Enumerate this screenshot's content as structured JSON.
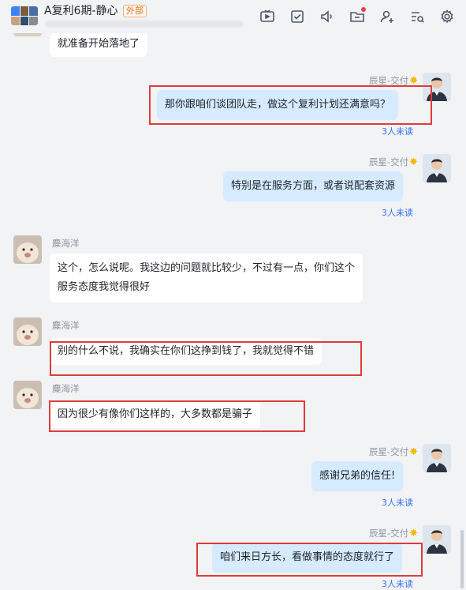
{
  "header": {
    "title": "A复利6期-静心",
    "external_tag": "外部",
    "avatar_colors": [
      "#3b82f6",
      "#7a5c3e",
      "#4a6fa5",
      "#c9a27a",
      "#2f4f6f",
      "#8a8a8a"
    ],
    "icons": [
      "video-icon",
      "task-check-icon",
      "speaker-icon",
      "folder-icon",
      "add-member-icon",
      "search-chat-icon",
      "settings-icon"
    ]
  },
  "messages": [
    {
      "id": "m0",
      "side": "them",
      "text": "就准备开始落地了"
    },
    {
      "id": "m1",
      "side": "me",
      "sender": "辰星-交付",
      "text": "那你跟咱们谈团队走，做这个复利计划还满意吗？",
      "read": "3人未读"
    },
    {
      "id": "m2",
      "side": "me",
      "sender": "辰星-交付",
      "text": "特别是在服务方面，或者说配套资源",
      "read": "3人未读"
    },
    {
      "id": "m3",
      "side": "them",
      "sender": "麋海洋",
      "line1": "这个，怎么说呢。我这边的问题就比较少，不过有一点，你们这个",
      "line2": "服务态度我觉得很好"
    },
    {
      "id": "m4",
      "side": "them",
      "sender": "麋海洋",
      "text": "别的什么不说，我确实在你们这挣到钱了，我就觉得不错"
    },
    {
      "id": "m5",
      "side": "them",
      "sender": "麋海洋",
      "text": "因为很少有像你们这样的，大多数都是骗子"
    },
    {
      "id": "m6",
      "side": "me",
      "sender": "辰星-交付",
      "text": "感谢兄弟的信任!",
      "read": "3人未读"
    },
    {
      "id": "m7",
      "side": "me",
      "sender": "辰星-交付",
      "text": "咱们来日方长，看做事情的态度就行了",
      "read": "3人未读"
    }
  ],
  "colors": {
    "highlight": "#e03b3b",
    "my_bubble": "#d6ebff",
    "their_bubble": "#ffffff",
    "unread_link": "#3370ff"
  }
}
